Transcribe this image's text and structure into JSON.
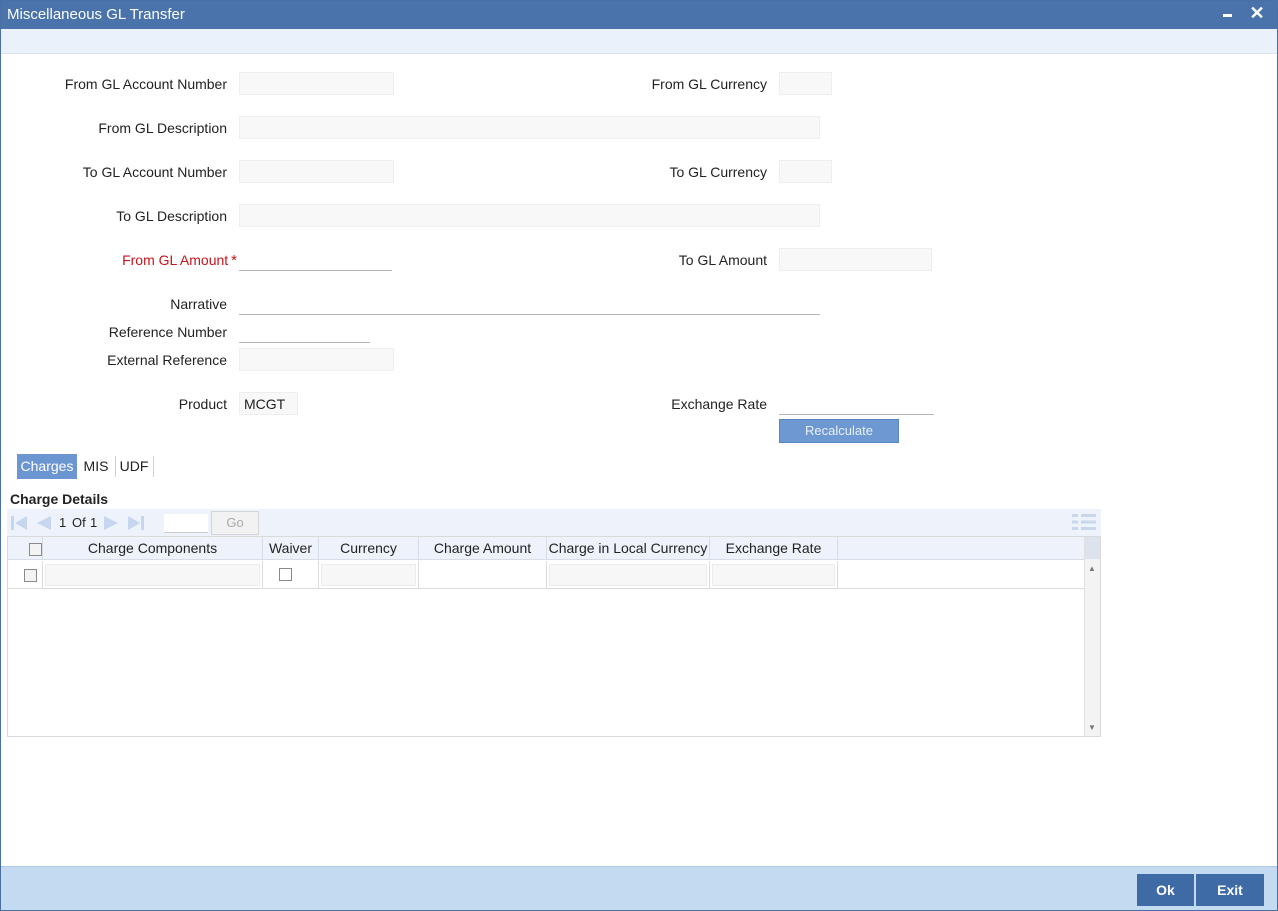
{
  "window": {
    "title": "Miscellaneous GL Transfer"
  },
  "form": {
    "from_gl_account_number": {
      "label": "From GL Account Number",
      "value": ""
    },
    "from_gl_currency": {
      "label": "From GL Currency",
      "value": ""
    },
    "from_gl_description": {
      "label": "From GL Description",
      "value": ""
    },
    "to_gl_account_number": {
      "label": "To GL Account Number",
      "value": ""
    },
    "to_gl_currency": {
      "label": "To GL Currency",
      "value": ""
    },
    "to_gl_description": {
      "label": "To GL Description",
      "value": ""
    },
    "from_gl_amount": {
      "label": "From GL Amount",
      "required_mark": "*",
      "value": ""
    },
    "to_gl_amount": {
      "label": "To GL Amount",
      "value": ""
    },
    "narrative": {
      "label": "Narrative",
      "value": ""
    },
    "reference_number": {
      "label": "Reference Number",
      "value": ""
    },
    "external_reference": {
      "label": "External Reference",
      "value": ""
    },
    "product": {
      "label": "Product",
      "value": "MCGT"
    },
    "exchange_rate": {
      "label": "Exchange Rate",
      "value": ""
    },
    "recalculate_label": "Recalculate"
  },
  "tabs": [
    {
      "label": "Charges",
      "active": true
    },
    {
      "label": "MIS",
      "active": false
    },
    {
      "label": "UDF",
      "active": false
    }
  ],
  "charges": {
    "section_title": "Charge Details",
    "pager": {
      "current": "1",
      "of_label": "Of",
      "total": "1",
      "go_label": "Go"
    },
    "columns": [
      "Charge Components",
      "Waiver",
      "Currency",
      "Charge Amount",
      "Charge in Local Currency",
      "Exchange Rate"
    ],
    "rows": [
      {
        "charge_component": "",
        "waiver": false,
        "currency": "",
        "charge_amount": "",
        "charge_local_currency": "",
        "exchange_rate": ""
      }
    ]
  },
  "footer": {
    "ok_label": "Ok",
    "exit_label": "Exit"
  },
  "colors": {
    "titlebar": "#4a72ab",
    "accent": "#6b96d1",
    "footer": "#c3daf0",
    "required": "#c4161c"
  }
}
